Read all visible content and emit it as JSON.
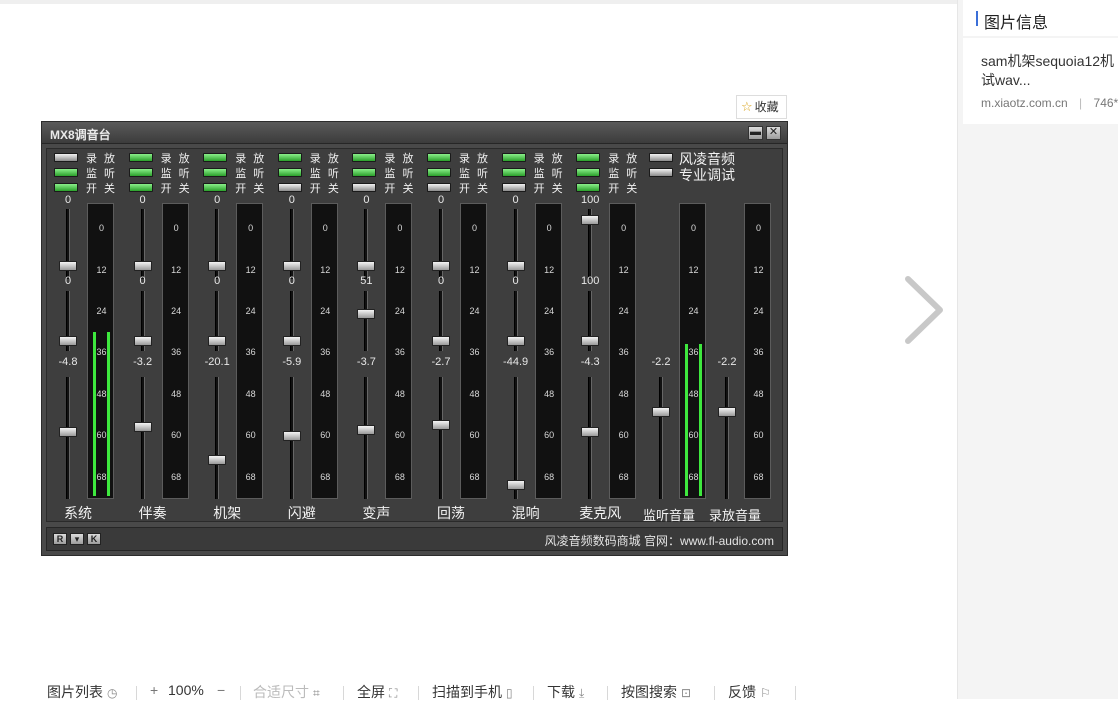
{
  "sidebar": {
    "title": "图片信息",
    "card": {
      "name_line1": "sam机架sequoia12机",
      "name_line2": "试wav...",
      "site": "m.xiaotz.com.cn",
      "divider": "|",
      "size": "746*"
    }
  },
  "favorite_label": "收藏",
  "mixer": {
    "title": "MX8调音台",
    "minimize": "▬",
    "close": "✕",
    "toggle_labels": [
      "录 放",
      "监 听",
      "开 关"
    ],
    "channels": [
      {
        "name": "系统",
        "top_value": "0",
        "mid_value": "0",
        "vol_value": "-4.8"
      },
      {
        "name": "伴奏",
        "top_value": "0",
        "mid_value": "0",
        "vol_value": "-3.2"
      },
      {
        "name": "机架",
        "top_value": "0",
        "mid_value": "0",
        "vol_value": "-20.1"
      },
      {
        "name": "闪避",
        "top_value": "0",
        "mid_value": "0",
        "vol_value": "-5.9"
      },
      {
        "name": "变声",
        "top_value": "0",
        "mid_value": "51",
        "vol_value": "-3.7"
      },
      {
        "name": "回荡",
        "top_value": "0",
        "mid_value": "0",
        "vol_value": "-2.7"
      },
      {
        "name": "混响",
        "top_value": "0",
        "mid_value": "0",
        "vol_value": "-44.9"
      },
      {
        "name": "麦克风",
        "top_value": "100",
        "mid_value": "100",
        "vol_value": "-4.3"
      }
    ],
    "brand_line1": "风凌音频",
    "brand_line2": "专业调试",
    "outputs": [
      {
        "name": "监听音量",
        "vol_value": "-2.2"
      },
      {
        "name": "录放音量",
        "vol_value": "-2.2"
      }
    ],
    "scale": [
      "0",
      "12",
      "24",
      "36",
      "48",
      "60",
      "68"
    ],
    "footer_buttons": [
      "R",
      "▾",
      "K"
    ],
    "footer_text": "风凌音频数码商城 官网：www.fl-audio.com"
  },
  "toolbar": {
    "list": "图片列表",
    "zoom_in": "+",
    "zoom": "100%",
    "zoom_out": "−",
    "fit": "合适尺寸",
    "fullscreen": "全屏",
    "scan": "扫描到手机",
    "download": "下载",
    "search": "按图搜索",
    "feedback": "反馈"
  }
}
